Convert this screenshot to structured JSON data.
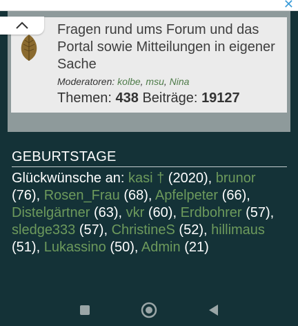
{
  "forum": {
    "description": "Fragen rund ums Forum und das Portal sowie Mitteilungen in eigener Sache",
    "moderators_label": "Moderatoren:",
    "moderators": [
      "kolbe",
      "msu",
      "Nina"
    ],
    "topics_label": "Themen:",
    "topics_count": "438",
    "posts_label": "Beiträge:",
    "posts_count": "19127"
  },
  "birthdays": {
    "title": "GEBURTSTAGE",
    "intro": "Glückwünsche an:",
    "entries": [
      {
        "name": "kasi †",
        "age": "(2020)"
      },
      {
        "name": "brunor",
        "age": "(76)"
      },
      {
        "name": "Rosen_Frau",
        "age": "(68)"
      },
      {
        "name": "Apfelpeter",
        "age": "(66)"
      },
      {
        "name": "Distelgärtner",
        "age": "(63)"
      },
      {
        "name": "vkr",
        "age": "(60)"
      },
      {
        "name": "Erdbohrer",
        "age": "(57)"
      },
      {
        "name": "sledge333",
        "age": "(57)"
      },
      {
        "name": "ChristineS",
        "age": "(52)"
      },
      {
        "name": "hillimaus",
        "age": "(51)"
      },
      {
        "name": "Lukassino",
        "age": "(50)"
      },
      {
        "name": "Admin",
        "age": "(21)"
      }
    ]
  },
  "icons": {
    "close": "close-icon",
    "collapse": "chevron-up-icon",
    "forum": "leaf-icon",
    "nav_recents": "square-icon",
    "nav_home": "circle-home-icon",
    "nav_back": "triangle-back-icon"
  },
  "colors": {
    "background": "#143237",
    "panel": "#8e9a9b",
    "card": "#ebebeb",
    "link": "#6d9a5c",
    "moderator_link": "#4f7c4a"
  }
}
